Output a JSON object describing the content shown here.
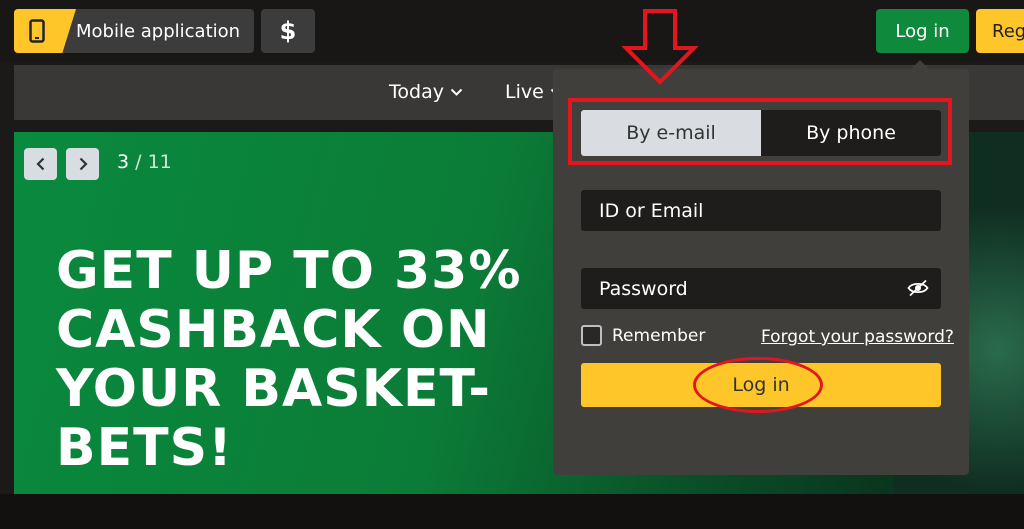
{
  "header": {
    "mobile_app_label": "Mobile application",
    "currency_symbol": "$",
    "login_label": "Log in",
    "register_label": "Reg"
  },
  "nav": {
    "items": [
      {
        "label": "Today"
      },
      {
        "label": "Live"
      }
    ]
  },
  "banner": {
    "pager_current": "3",
    "pager_total": "/ 11",
    "headline_lines": [
      "GET UP TO 33%",
      "CASHBACK ON",
      "YOUR BASKET-",
      "BETS!"
    ]
  },
  "login_panel": {
    "tabs": [
      {
        "label": "By e-mail",
        "active": true
      },
      {
        "label": "By phone",
        "active": false
      }
    ],
    "id_placeholder": "ID or Email",
    "password_placeholder": "Password",
    "remember_label": "Remember",
    "forgot_label": "Forgot your password?",
    "submit_label": "Log in"
  },
  "colors": {
    "accent_yellow": "#ffc629",
    "login_green": "#0f8a3d",
    "annotation_red": "#e1161f",
    "banner_green": "#0a8a3e"
  }
}
